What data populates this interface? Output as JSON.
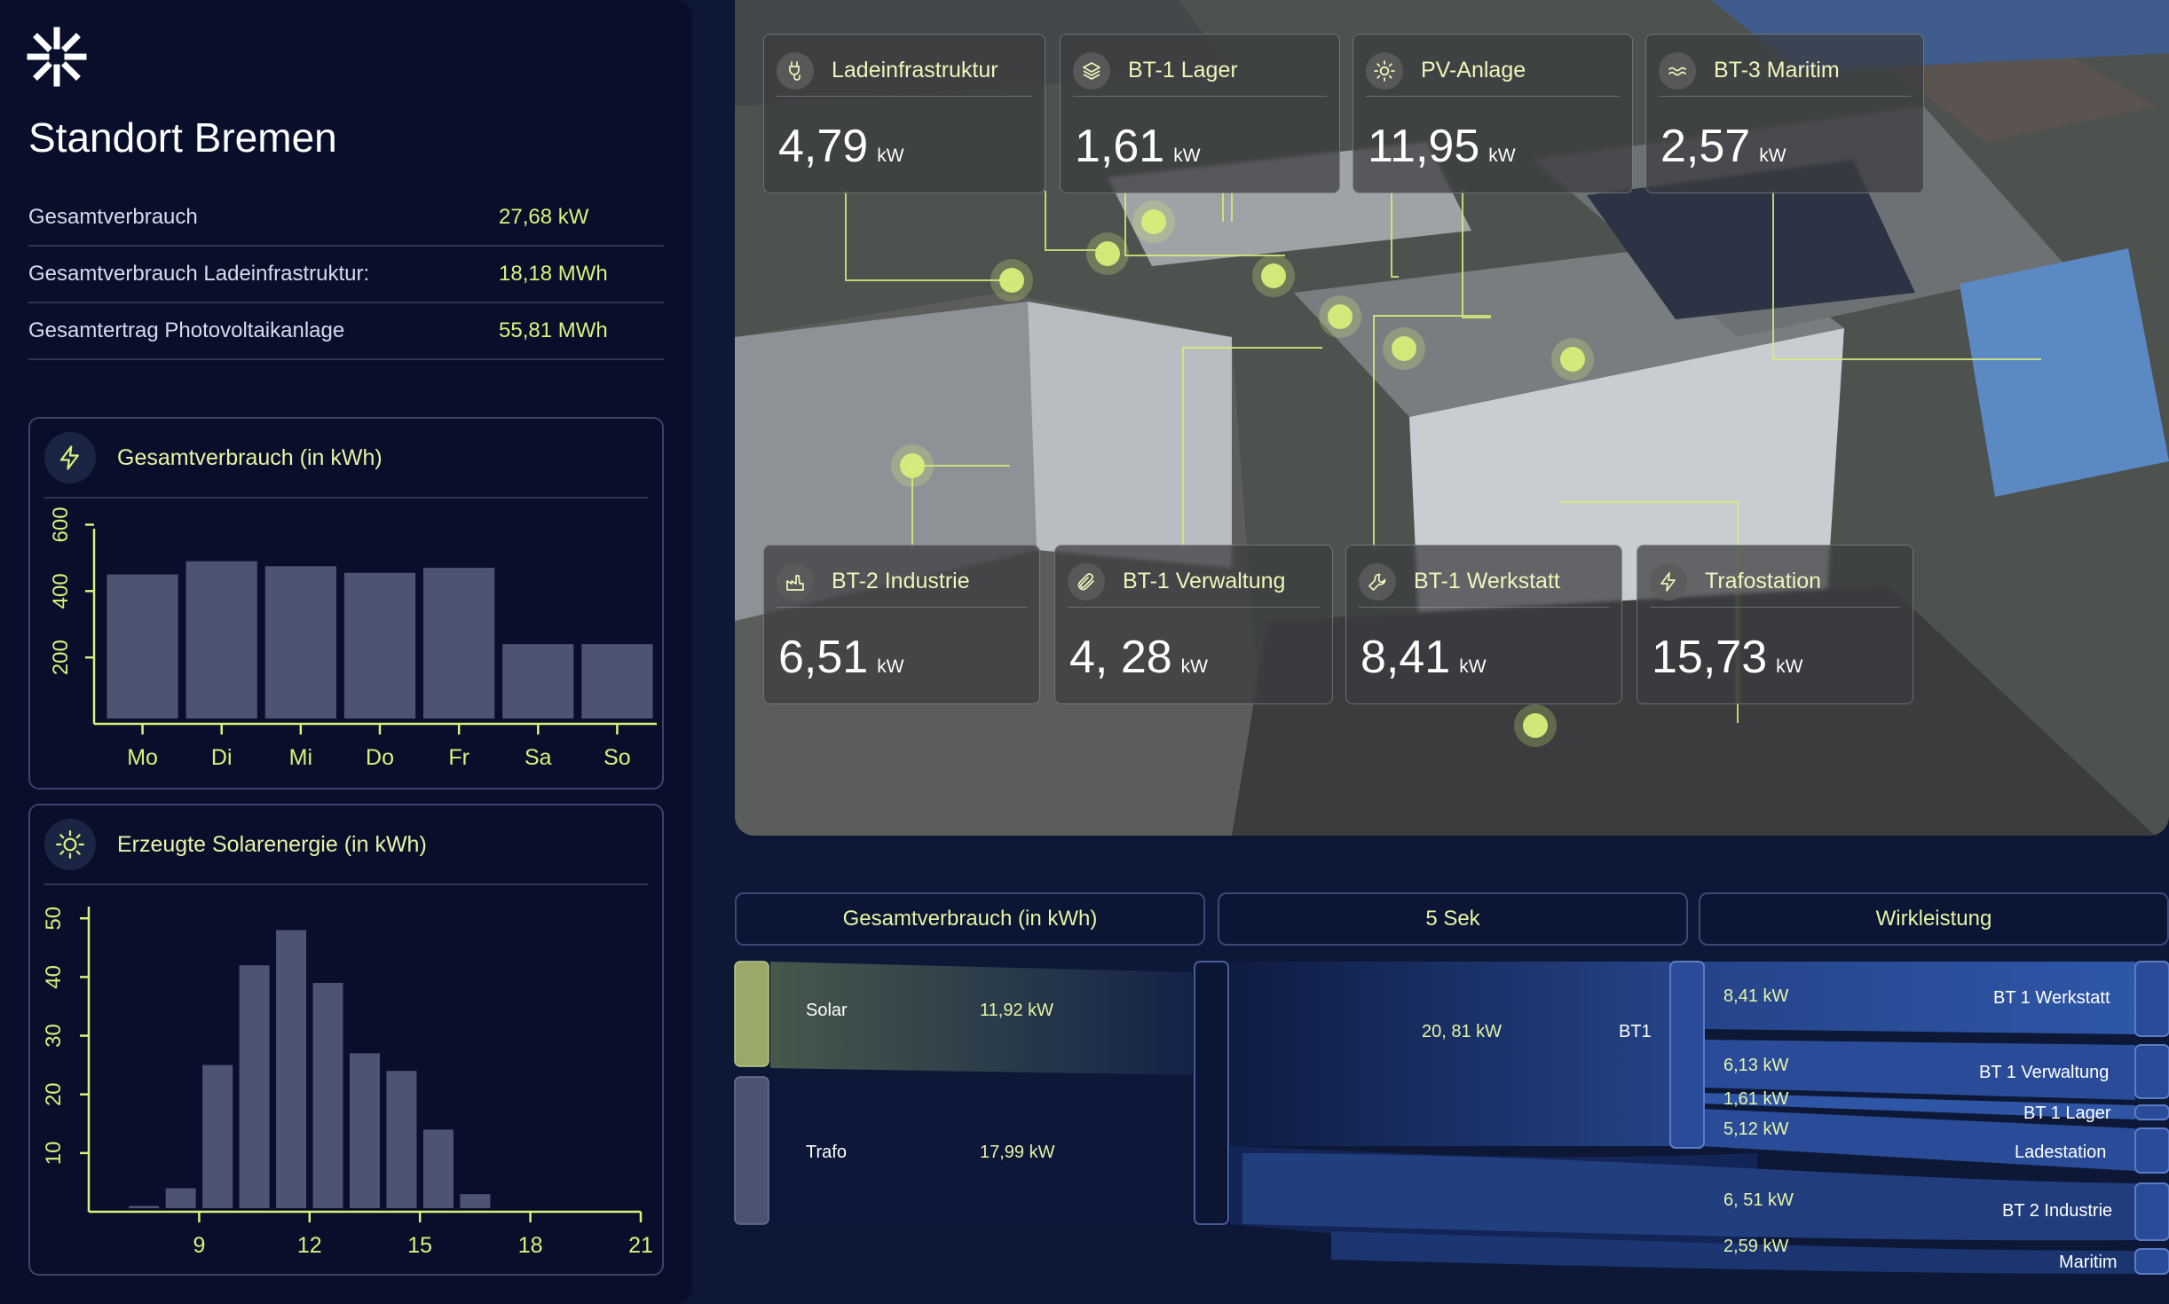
{
  "site": {
    "title": "Standort Bremen"
  },
  "stats": [
    {
      "label": "Gesamtverbrauch",
      "value": "27,68 kW"
    },
    {
      "label": "Gesamtverbrauch Ladeinfrastruktur:",
      "value": "18,18 MWh"
    },
    {
      "label": "Gesamtertrag Photovoltaikanlage",
      "value": "55,81 MWh"
    }
  ],
  "colors": {
    "accent": "#d9f27a",
    "bar": "#4d5471",
    "panel": "#090f2b",
    "background": "#0d1836"
  },
  "consumption_card": {
    "title": "Gesamtverbrauch (in kWh)",
    "icon": "lightning-icon"
  },
  "solar_card": {
    "title": "Erzeugte Solarenergie (in kWh)",
    "icon": "sun-icon"
  },
  "chart_data": [
    {
      "type": "bar",
      "title": "Gesamtverbrauch (in kWh)",
      "categories": [
        "Mo",
        "Di",
        "Mi",
        "Do",
        "Fr",
        "Sa",
        "So"
      ],
      "values": [
        450,
        490,
        475,
        455,
        470,
        240,
        240
      ],
      "y_ticks": [
        200,
        400,
        600
      ],
      "ylim": [
        0,
        620
      ],
      "grid": false
    },
    {
      "type": "bar",
      "title": "Erzeugte Solarenergie (in kWh)",
      "x": [
        7,
        8,
        9,
        10,
        11,
        12,
        13,
        14,
        15,
        16,
        17
      ],
      "values": [
        1,
        4,
        25,
        42,
        48,
        39,
        27,
        24,
        14,
        3,
        0
      ],
      "x_ticks": [
        9,
        12,
        15,
        18,
        21
      ],
      "y_ticks": [
        10,
        20,
        30,
        40,
        50
      ],
      "xlim": [
        6,
        21
      ],
      "ylim": [
        0,
        52
      ],
      "grid": false
    }
  ],
  "tiles": [
    {
      "name": "Ladeinfrastruktur",
      "value": "4,79",
      "unit": "kW",
      "icon": "plug-icon"
    },
    {
      "name": "BT-1 Lager",
      "value": "1,61",
      "unit": "kW",
      "icon": "layers-icon"
    },
    {
      "name": "PV-Anlage",
      "value": "11,95",
      "unit": "kW",
      "icon": "sun-icon"
    },
    {
      "name": "BT-3 Maritim",
      "value": "2,57",
      "unit": "kW",
      "icon": "waves-icon"
    },
    {
      "name": "BT-2 Industrie",
      "value": "6,51",
      "unit": "kW",
      "icon": "factory-icon"
    },
    {
      "name": "BT-1 Verwaltung",
      "value": "4, 28",
      "unit": "kW",
      "icon": "paperclip-icon"
    },
    {
      "name": "BT-1 Werkstatt",
      "value": "8,41",
      "unit": "kW",
      "icon": "wrench-icon"
    },
    {
      "name": "Trafostation",
      "value": "15,73",
      "unit": "kW",
      "icon": "lightning-icon"
    }
  ],
  "flow": {
    "headers": [
      "Gesamtverbrauch (in kWh)",
      "5 Sek",
      "Wirkleistung"
    ],
    "sources": [
      {
        "label": "Solar",
        "value": "11,92 kW"
      },
      {
        "label": "Trafo",
        "value": "17,99 kW"
      }
    ],
    "middle": {
      "value": "20, 81 kW",
      "label": "BT1"
    },
    "targets": [
      {
        "value": "8,41 kW",
        "label": "BT 1 Werkstatt"
      },
      {
        "value": "6,13 kW",
        "label": "BT 1 Verwaltung"
      },
      {
        "value": "1,61 kW",
        "label": "BT 1 Lager"
      },
      {
        "value": "5,12 kW",
        "label": "Ladestation"
      },
      {
        "value": "6, 51 kW",
        "label": "BT 2 Industrie"
      },
      {
        "value": "2,59 kW",
        "label": "Maritim"
      }
    ]
  }
}
